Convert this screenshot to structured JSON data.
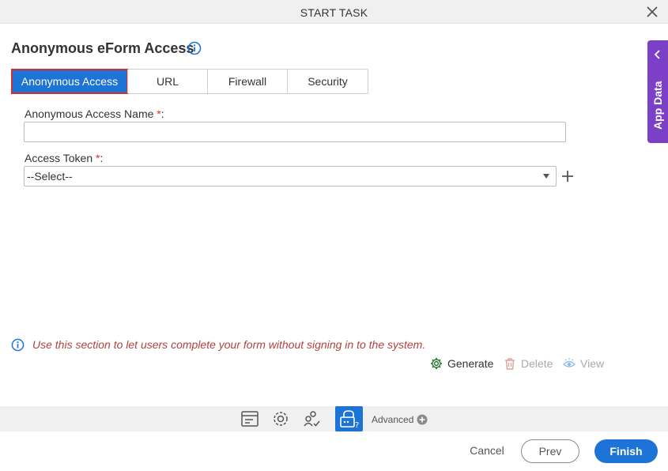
{
  "window": {
    "title": "START TASK"
  },
  "page": {
    "heading": "Anonymous eForm Access"
  },
  "tabs": [
    {
      "label": "Anonymous Access",
      "active": true
    },
    {
      "label": "URL",
      "active": false
    },
    {
      "label": "Firewall",
      "active": false
    },
    {
      "label": "Security",
      "active": false
    }
  ],
  "form": {
    "name_label": "Anonymous Access Name",
    "name_value": "",
    "token_label": "Access Token",
    "required_mark": "*",
    "label_suffix": ":",
    "token_selected": "--Select--"
  },
  "side_panel": {
    "label": "App Data"
  },
  "note": "Use this section to let users complete your form without signing in to the system.",
  "actions": {
    "generate": "Generate",
    "delete": "Delete",
    "view": "View"
  },
  "toolbar": {
    "advanced": "Advanced"
  },
  "buttons": {
    "cancel": "Cancel",
    "prev": "Prev",
    "finish": "Finish"
  },
  "colors": {
    "accent": "#1e74d6",
    "side_panel": "#7b3fc8",
    "note_text": "#b0413e",
    "generate": "#2e7d32",
    "disabled": "#a9a9a9"
  }
}
